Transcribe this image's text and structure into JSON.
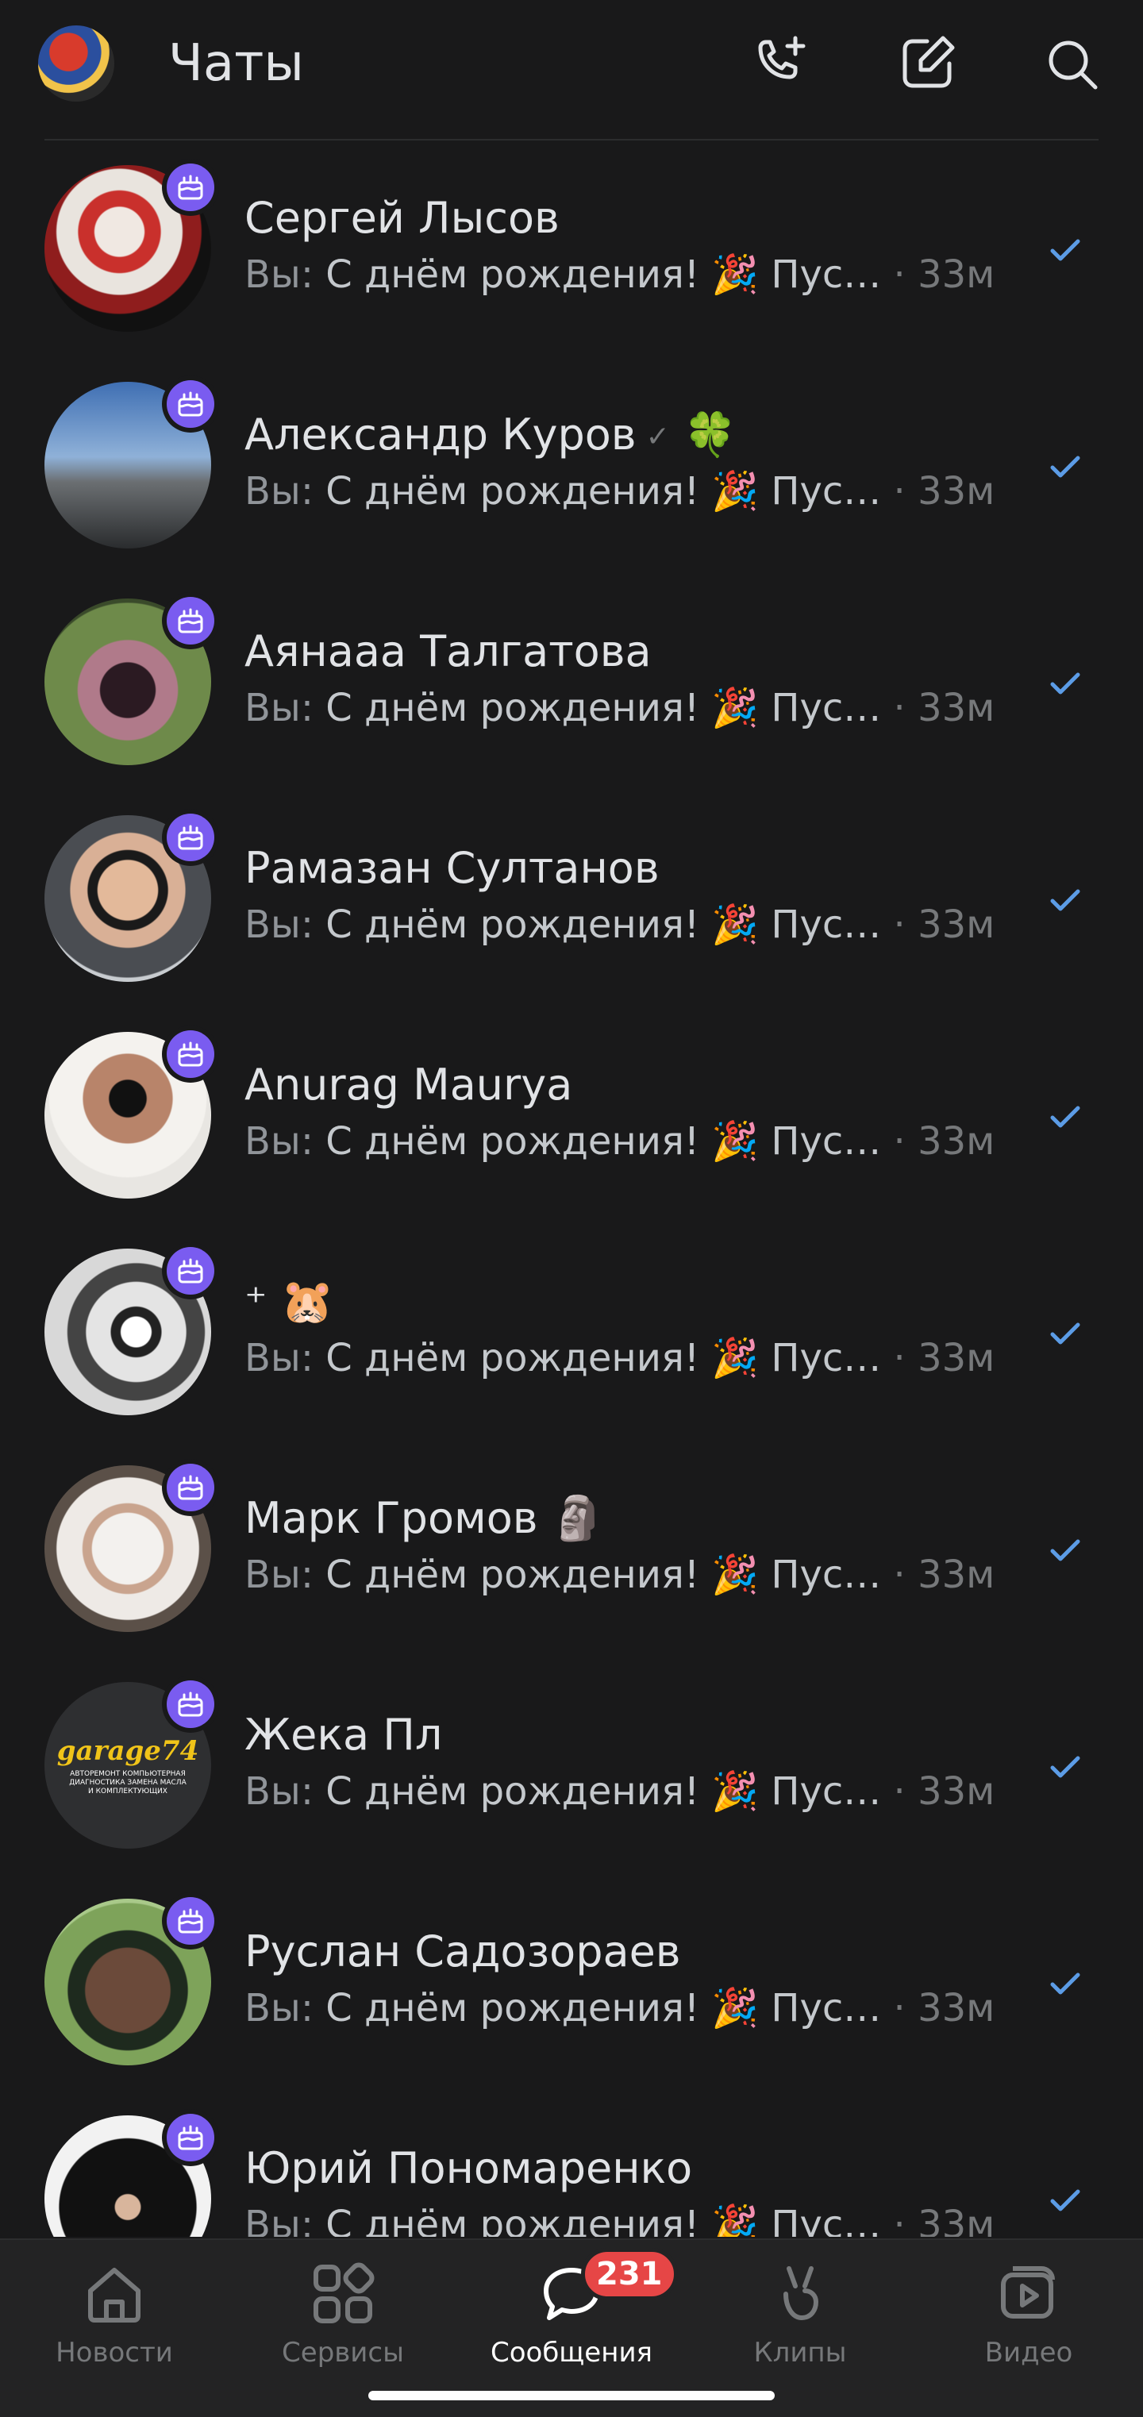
{
  "header": {
    "title": "Чаты"
  },
  "chats": [
    {
      "name": "Сергей Лысов",
      "name_extra": "",
      "verified": false,
      "you_prefix": "Вы:",
      "message": "С днём рождения! 🎉 Пус…",
      "time": "· 33м"
    },
    {
      "name": "Александр Куров",
      "name_extra": "🍀",
      "verified": true,
      "you_prefix": "Вы:",
      "message": "С днём рождения! 🎉 Пус…",
      "time": "· 33м"
    },
    {
      "name": "Аянааа Талгатова",
      "name_extra": "",
      "verified": false,
      "you_prefix": "Вы:",
      "message": "С днём рождения! 🎉 Пус…",
      "time": "· 33м"
    },
    {
      "name": "Рамазан Султанов",
      "name_extra": "",
      "verified": false,
      "you_prefix": "Вы:",
      "message": "С днём рождения! 🎉 Пус…",
      "time": "· 33м"
    },
    {
      "name": "Anurag Maurya",
      "name_extra": "",
      "verified": false,
      "you_prefix": "Вы:",
      "message": "С днём рождения! 🎉 Пус…",
      "time": "· 33м"
    },
    {
      "name": "⁺ 🐹",
      "name_extra": "",
      "verified": false,
      "you_prefix": "Вы:",
      "message": "С днём рождения! 🎉 Пус…",
      "time": "· 33м"
    },
    {
      "name": "Марк Громов",
      "name_extra": "🗿",
      "verified": false,
      "you_prefix": "Вы:",
      "message": "С днём рождения! 🎉 Пус…",
      "time": "· 33м"
    },
    {
      "name": "Жека Пл",
      "name_extra": "",
      "verified": false,
      "you_prefix": "Вы:",
      "message": "С днём рождения! 🎉 Пус…",
      "time": "· 33м"
    },
    {
      "name": "Руслан Садозораев",
      "name_extra": "",
      "verified": false,
      "you_prefix": "Вы:",
      "message": "С днём рождения! 🎉 Пус…",
      "time": "· 33м"
    },
    {
      "name": "Юрий Пономаренко",
      "name_extra": "",
      "verified": false,
      "you_prefix": "Вы:",
      "message": "С днём рождения! 🎉 Пус…",
      "time": "· 33м"
    }
  ],
  "avatar_texts": {
    "garage_logo": "garage74",
    "garage_sub": "АВТОРЕМОНТ КОМПЬЮТЕРНАЯ ДИАГНОСТИКА ЗАМЕНА МАСЛА И КОМПЛЕКТУЮЩИХ"
  },
  "tabbar": {
    "tabs": [
      {
        "label": "Новости",
        "icon": "home-icon"
      },
      {
        "label": "Сервисы",
        "icon": "services-grid-icon"
      },
      {
        "label": "Сообщения",
        "icon": "message-bubble-icon",
        "badge": "231",
        "active": true
      },
      {
        "label": "Клипы",
        "icon": "clips-icon"
      },
      {
        "label": "Видео",
        "icon": "video-play-icon"
      }
    ]
  },
  "colors": {
    "background": "#19191a",
    "accent": "#5c9ce6",
    "birthday_badge": "#7a5cf0",
    "notification_badge": "#e64646"
  }
}
